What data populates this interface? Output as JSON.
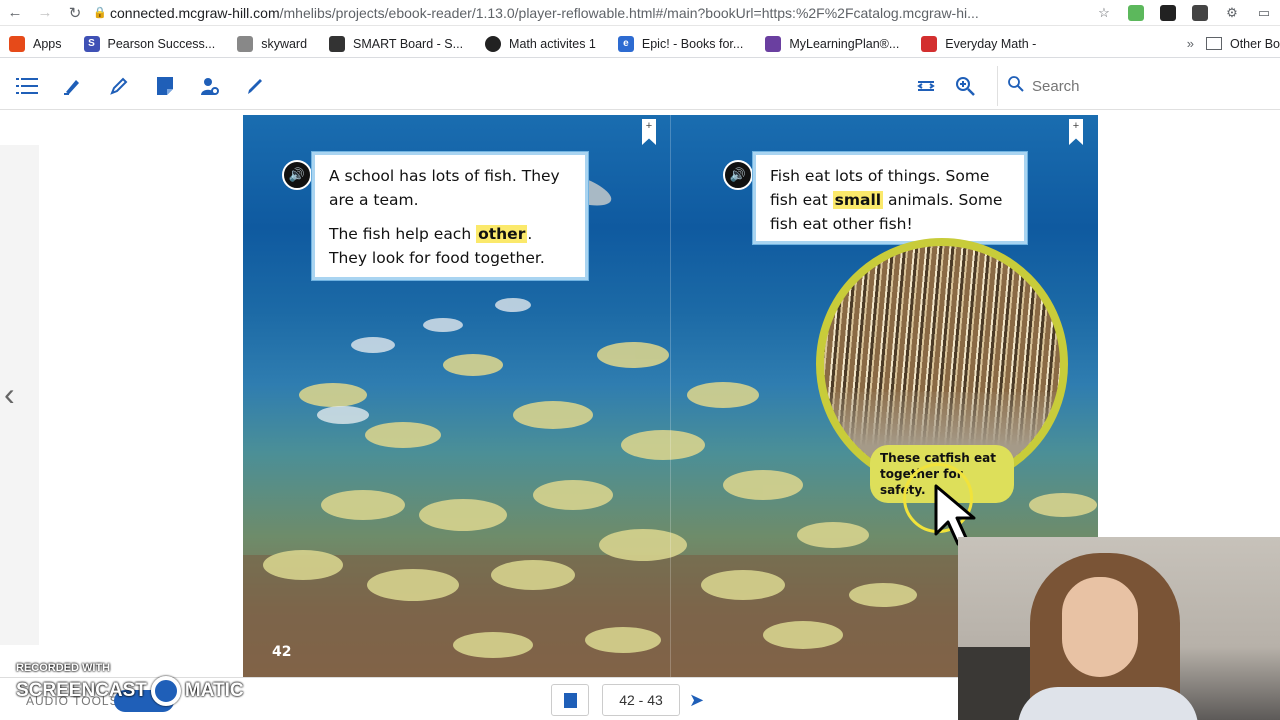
{
  "browser": {
    "url_host": "connected.mcgraw-hill.com",
    "url_path": "/mhelibs/projects/ebook-reader/1.13.0/player-reflowable.html#/main?bookUrl=https:%2F%2Fcatalog.mcgraw-hi...",
    "bookmarks": [
      {
        "label": "Apps",
        "color": "#e64a19"
      },
      {
        "label": "Pearson Success...",
        "color": "#3f51b5"
      },
      {
        "label": "skyward",
        "color": "#555555"
      },
      {
        "label": "SMART Board - S...",
        "color": "#333333"
      },
      {
        "label": "Math activites 1",
        "color": "#222222"
      },
      {
        "label": "Epic! - Books for...",
        "color": "#2d6bd1"
      },
      {
        "label": "MyLearningPlan®...",
        "color": "#6a3fa0"
      },
      {
        "label": "Everyday Math -",
        "color": "#d32f2f"
      }
    ],
    "more_bookmarks": "»",
    "other_bookmarks": "Other Bo"
  },
  "toolbar": {
    "search_placeholder": "Search"
  },
  "book": {
    "left_text_p1": "A school has lots of fish. They are a team.",
    "left_text_p2_before": "The fish help each ",
    "left_text_p2_highlight": "other",
    "left_text_p2_after": ". They look for food together.",
    "right_text_before": "Fish eat lots of things. Some fish eat ",
    "right_text_highlight": "small",
    "right_text_after": " animals. Some fish eat other fish!",
    "caption": "These catfish eat together for safety.",
    "page_number": "42",
    "bookmark_glyph": "+"
  },
  "footer": {
    "page_range": "42 - 43",
    "audio_label": "AUDIO TOOLS:"
  },
  "watermark": {
    "recorded_with": "RECORDED WITH",
    "brand_left": "SCREENCAST",
    "brand_right": "MATIC"
  },
  "colors": {
    "accent": "#1f5fb8",
    "highlight": "#fbe96b",
    "caption_bg": "#dddf5a"
  }
}
